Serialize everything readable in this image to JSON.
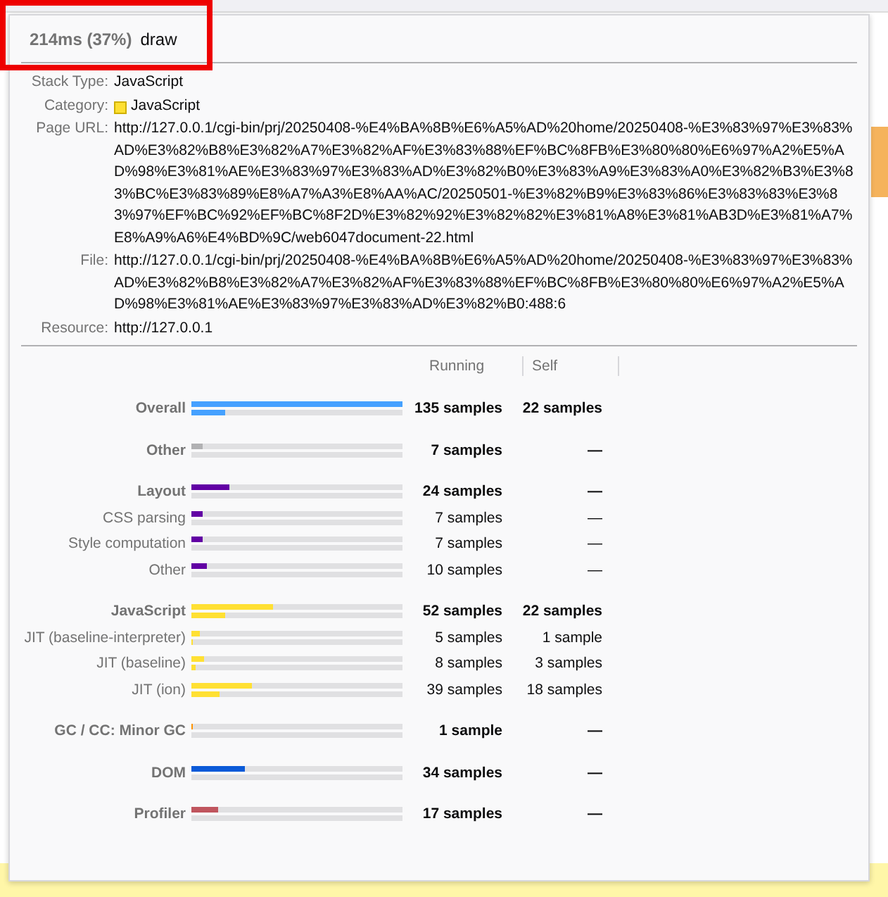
{
  "tooltip": {
    "duration": "214ms (37%)",
    "name": "draw",
    "highlighted": true,
    "details": [
      {
        "label": "Stack Type:",
        "value": "JavaScript"
      },
      {
        "label": "Category:",
        "value": "JavaScript",
        "color": "#ffe033"
      },
      {
        "label": "Page URL:",
        "value": "http://127.0.0.1/cgi-bin/prj/20250408-%E4%BA%8B%E6%A5%AD%20home/20250408-%E3%83%97%E3%83%AD%E3%82%B8%E3%82%A7%E3%82%AF%E3%83%88%EF%BC%8FB%E3%80%80%E6%97%A2%E5%AD%98%E3%81%AE%E3%83%97%E3%83%AD%E3%82%B0%E3%83%A9%E3%83%A0%E3%82%B3%E3%83%BC%E3%83%89%E8%A7%A3%E8%AA%AC/20250501-%E3%82%B9%E3%83%86%E3%83%83%E3%83%97%EF%BC%92%EF%BC%8F2D%E3%82%92%E3%82%82%E3%81%A8%E3%81%AB3D%E3%81%A7%E8%A9%A6%E4%BD%9C/web6047document-22.html"
      },
      {
        "label": "File:",
        "value": "http://127.0.0.1/cgi-bin/prj/20250408-%E4%BA%8B%E6%A5%AD%20home/20250408-%E3%83%97%E3%83%AD%E3%82%B8%E3%82%A7%E3%82%AF%E3%83%88%EF%BC%8FB%E3%80%80%E6%97%A2%E5%AD%98%E3%81%AE%E3%83%97%E3%83%AD%E3%82%B0:488:6"
      },
      {
        "label": "Resource:",
        "value": "http://127.0.0.1"
      }
    ],
    "columns": [
      "Running",
      "Self"
    ],
    "categories": [
      {
        "name": "Overall",
        "color": "#45a1ff",
        "running": {
          "text": "135 samples",
          "level": 1
        },
        "self": {
          "text": "22 samples",
          "level": 0.163
        }
      },
      {
        "name": "Other",
        "color": "#b1b1b3",
        "running": {
          "text": "7 samples",
          "level": 0.052
        },
        "self": {
          "text": "—"
        }
      },
      {
        "name": "Layout",
        "color": "#6200a4",
        "running": {
          "text": "24 samples",
          "level": 0.178
        },
        "self": {
          "text": "—"
        },
        "children": [
          {
            "name": "CSS parsing",
            "running": {
              "text": "7 samples",
              "level": 0.052
            },
            "self": {
              "text": "—"
            }
          },
          {
            "name": "Style computation",
            "running": {
              "text": "7 samples",
              "level": 0.052
            },
            "self": {
              "text": "—"
            }
          },
          {
            "name": "Other",
            "running": {
              "text": "10 samples",
              "level": 0.074
            },
            "self": {
              "text": "—"
            }
          }
        ]
      },
      {
        "name": "JavaScript",
        "color": "#ffe033",
        "running": {
          "text": "52 samples",
          "level": 0.385
        },
        "self": {
          "text": "22 samples",
          "level": 0.163
        },
        "children": [
          {
            "name": "JIT (baseline-interpreter)",
            "running": {
              "text": "5 samples",
              "level": 0.037
            },
            "self": {
              "text": "1 sample",
              "level": 0.0074
            }
          },
          {
            "name": "JIT (baseline)",
            "running": {
              "text": "8 samples",
              "level": 0.059
            },
            "self": {
              "text": "3 samples",
              "level": 0.022
            }
          },
          {
            "name": "JIT (ion)",
            "running": {
              "text": "39 samples",
              "level": 0.289
            },
            "self": {
              "text": "18 samples",
              "level": 0.133
            }
          }
        ]
      },
      {
        "name": "GC / CC: Minor GC",
        "color": "#ff9400",
        "running": {
          "text": "1 sample",
          "level": 0.0074
        },
        "self": {
          "text": "—"
        }
      },
      {
        "name": "DOM",
        "color": "#0a5ad8",
        "running": {
          "text": "34 samples",
          "level": 0.252
        },
        "self": {
          "text": "—"
        }
      },
      {
        "name": "Profiler",
        "color": "#c0555e",
        "running": {
          "text": "17 samples",
          "level": 0.126
        },
        "self": {
          "text": "—"
        }
      }
    ]
  }
}
